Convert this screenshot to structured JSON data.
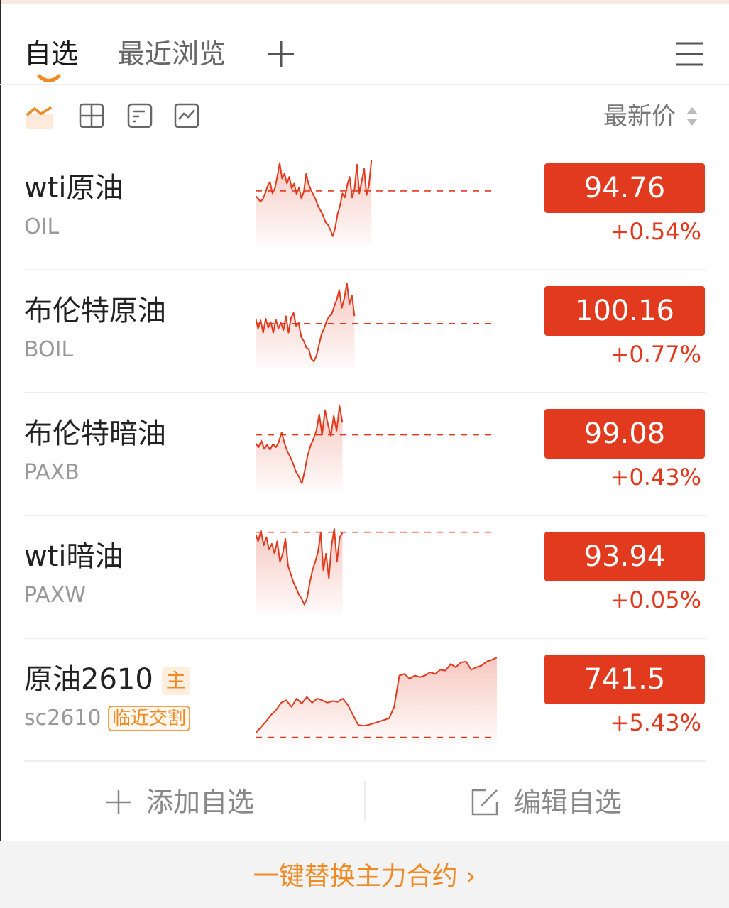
{
  "tabs": {
    "active": "自选",
    "recent": "最近浏览"
  },
  "toolbar": {
    "view_icons": [
      "line-view-icon",
      "grid-view-icon",
      "card-view-icon",
      "chart-view-icon"
    ],
    "sort_label": "最新价"
  },
  "rows": [
    {
      "name": "wti原油",
      "code": "OIL",
      "price": "94.76",
      "change": "+0.54%",
      "spark": {
        "ref": 0.37,
        "fill_end": 0.48,
        "points": [
          0.43,
          0.46,
          0.5,
          0.47,
          0.4,
          0.31,
          0.26,
          0.4,
          0.34,
          0.2,
          0.03,
          0.22,
          0.16,
          0.28,
          0.2,
          0.34,
          0.28,
          0.41,
          0.33,
          0.46,
          0.38,
          0.16,
          0.29,
          0.36,
          0.42,
          0.48,
          0.56,
          0.61,
          0.67,
          0.75,
          0.78,
          0.84,
          0.92,
          0.82,
          0.65,
          0.55,
          0.4,
          0.45,
          0.3,
          0.2,
          0.45,
          0.35,
          0.05,
          0.4,
          0.25,
          0.1,
          0.42,
          0.3,
          0.0
        ]
      }
    },
    {
      "name": "布伦特原油",
      "code": "BOIL",
      "price": "100.16",
      "change": "+0.77%",
      "spark": {
        "ref": 0.49,
        "fill_end": 0.41,
        "points": [
          0.42,
          0.55,
          0.45,
          0.6,
          0.43,
          0.54,
          0.47,
          0.6,
          0.44,
          0.55,
          0.48,
          0.57,
          0.4,
          0.6,
          0.42,
          0.36,
          0.52,
          0.48,
          0.65,
          0.7,
          0.78,
          0.8,
          0.92,
          0.95,
          0.88,
          0.75,
          0.62,
          0.55,
          0.46,
          0.4,
          0.38,
          0.28,
          0.2,
          0.08,
          0.3,
          0.18,
          0.0,
          0.25,
          0.15,
          0.4
        ]
      }
    },
    {
      "name": "布伦特暗油",
      "code": "PAXB",
      "price": "99.08",
      "change": "+0.43%",
      "spark": {
        "ref": 0.35,
        "fill_end": 0.36,
        "points": [
          0.45,
          0.5,
          0.42,
          0.52,
          0.47,
          0.53,
          0.46,
          0.5,
          0.44,
          0.32,
          0.45,
          0.55,
          0.62,
          0.7,
          0.8,
          0.86,
          0.94,
          0.78,
          0.6,
          0.48,
          0.4,
          0.3,
          0.1,
          0.35,
          0.05,
          0.22,
          0.36,
          0.12,
          0.3,
          0.0,
          0.2
        ]
      }
    },
    {
      "name": "wti暗油",
      "code": "PAXW",
      "price": "93.94",
      "change": "+0.05%",
      "spark": {
        "ref": 0.04,
        "fill_end": 0.36,
        "points": [
          0.06,
          0.15,
          0.02,
          0.2,
          0.1,
          0.25,
          0.18,
          0.3,
          0.15,
          0.4,
          0.3,
          0.12,
          0.45,
          0.55,
          0.65,
          0.72,
          0.8,
          0.85,
          0.92,
          0.84,
          0.65,
          0.5,
          0.4,
          0.28,
          0.05,
          0.5,
          0.3,
          0.6,
          0.2,
          0.0,
          0.4,
          0.1,
          0.05
        ]
      }
    },
    {
      "name": "原油2610",
      "code": "sc2610",
      "tag": "主",
      "badge": "临近交割",
      "price": "741.5",
      "change": "+5.43%",
      "spark": {
        "ref": 0.97,
        "fill_end": 1.0,
        "points": [
          0.92,
          0.85,
          0.78,
          0.7,
          0.64,
          0.55,
          0.52,
          0.6,
          0.5,
          0.56,
          0.48,
          0.55,
          0.5,
          0.52,
          0.55,
          0.53,
          0.54,
          0.5,
          0.58,
          0.7,
          0.82,
          0.83,
          0.82,
          0.8,
          0.78,
          0.76,
          0.74,
          0.6,
          0.22,
          0.2,
          0.26,
          0.22,
          0.24,
          0.22,
          0.18,
          0.2,
          0.15,
          0.16,
          0.08,
          0.12,
          0.06,
          0.05,
          0.15,
          0.12,
          0.1,
          0.05,
          0.03,
          0.0
        ]
      }
    }
  ],
  "actions": {
    "add": "添加自选",
    "edit": "编辑自选"
  },
  "footer": {
    "link": "一键替换主力合约 ›"
  },
  "colors": {
    "up": "#e23a1e",
    "accent": "#f08a24"
  }
}
